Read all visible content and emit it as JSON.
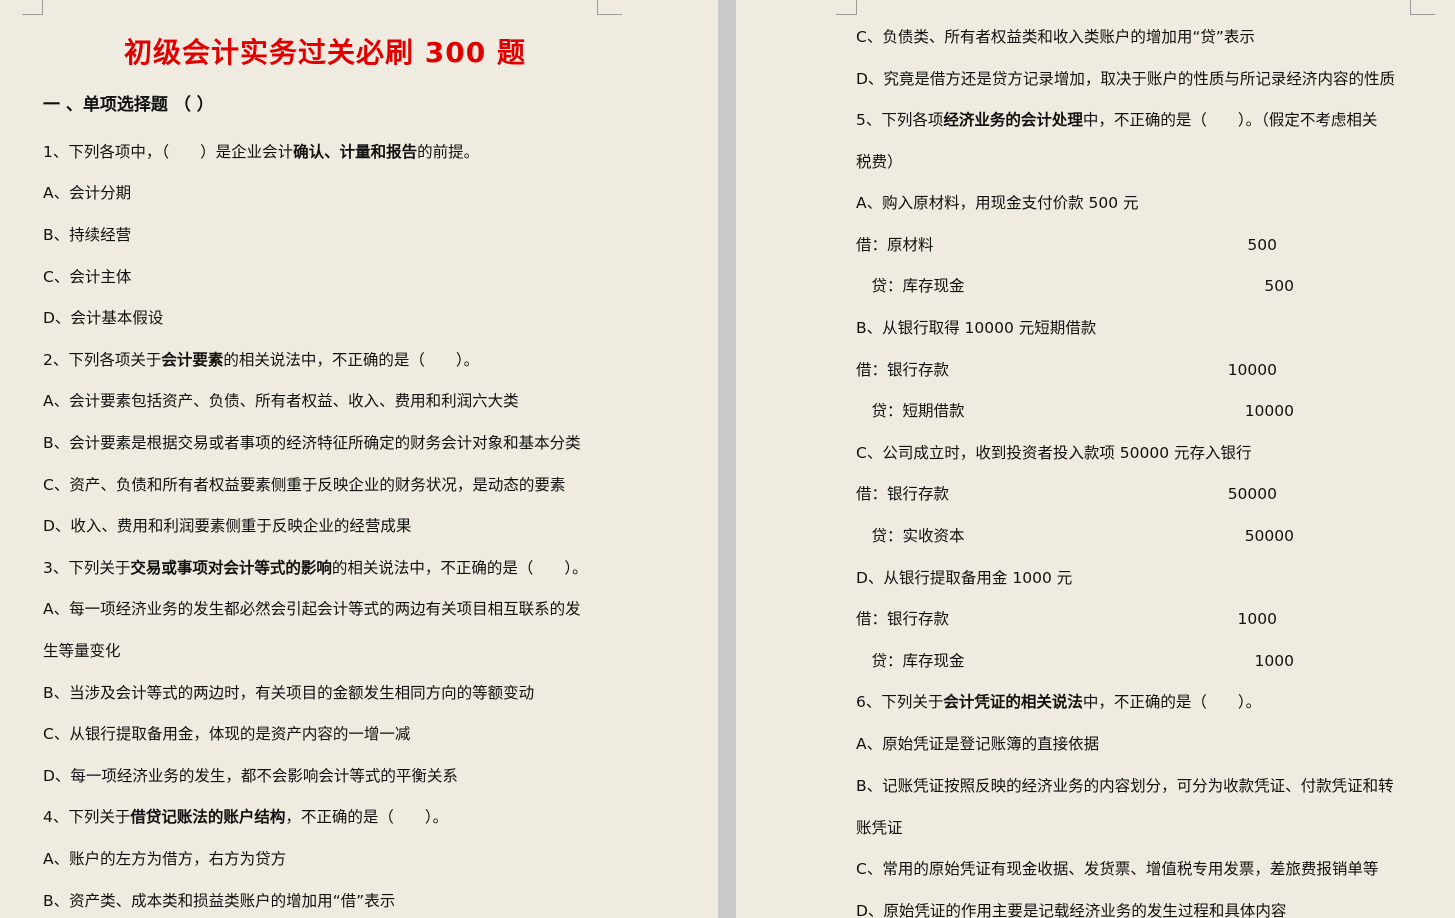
{
  "left": {
    "title": "初级会计实务过关必刷 300 题",
    "section": "一 、单项选择题 （ ）",
    "lines": [
      {
        "parts": [
          {
            "t": "1、下列各项中，（　　）是企业会计"
          },
          {
            "t": "确认、计量和报告",
            "b": true
          },
          {
            "t": "的前提。"
          }
        ]
      },
      {
        "parts": [
          {
            "t": "A、会计分期"
          }
        ]
      },
      {
        "parts": [
          {
            "t": "B、持续经营"
          }
        ]
      },
      {
        "parts": [
          {
            "t": "C、会计主体"
          }
        ]
      },
      {
        "parts": [
          {
            "t": "D、会计基本假设"
          }
        ]
      },
      {
        "parts": [
          {
            "t": "2、下列各项关于"
          },
          {
            "t": "会计要素",
            "b": true
          },
          {
            "t": "的相关说法中，不正确的是（　　）。"
          }
        ]
      },
      {
        "parts": [
          {
            "t": "A、会计要素包括资产、负债、所有者权益、收入、费用和利润六大类"
          }
        ]
      },
      {
        "parts": [
          {
            "t": "B、会计要素是根据交易或者事项的经济特征所确定的财务会计对象和基本分类"
          }
        ]
      },
      {
        "parts": [
          {
            "t": "C、资产、负债和所有者权益要素侧重于反映企业的财务状况，是动态的要素"
          }
        ]
      },
      {
        "parts": [
          {
            "t": "D、收入、费用和利润要素侧重于反映企业的经营成果"
          }
        ]
      },
      {
        "parts": [
          {
            "t": "3、下列关于"
          },
          {
            "t": "交易或事项对会计等式的影响",
            "b": true
          },
          {
            "t": "的相关说法中，不正确的是（　　）。"
          }
        ]
      },
      {
        "parts": [
          {
            "t": "A、每一项经济业务的发生都必然会引起会计等式的两边有关项目相互联系的发"
          }
        ]
      },
      {
        "parts": [
          {
            "t": "生等量变化"
          }
        ]
      },
      {
        "parts": [
          {
            "t": "B、当涉及会计等式的两边时，有关项目的金额发生相同方向的等额变动"
          }
        ]
      },
      {
        "parts": [
          {
            "t": "C、从银行提取备用金，体现的是资产内容的一增一减"
          }
        ]
      },
      {
        "parts": [
          {
            "t": "D、每一项经济业务的发生，都不会影响会计等式的平衡关系"
          }
        ]
      },
      {
        "parts": [
          {
            "t": "4、下列关于"
          },
          {
            "t": "借贷记账法的账户结构",
            "b": true
          },
          {
            "t": "，不正确的是（　　）。"
          }
        ]
      },
      {
        "parts": [
          {
            "t": "A、账户的左方为借方，右方为贷方"
          }
        ]
      },
      {
        "parts": [
          {
            "t": "B、资产类、成本类和损益类账户的增加用“借”表示"
          }
        ]
      }
    ]
  },
  "right": {
    "lines": [
      {
        "parts": [
          {
            "t": "C、负债类、所有者权益类和收入类账户的增加用“贷”表示"
          }
        ]
      },
      {
        "parts": [
          {
            "t": "D、究竟是借方还是贷方记录增加，取决于账户的性质与所记录经济内容的性质"
          }
        ]
      },
      {
        "parts": [
          {
            "t": "5、下列各项"
          },
          {
            "t": "经济业务的会计处理",
            "b": true
          },
          {
            "t": "中，不正确的是（　　）。（假定不考虑相关"
          }
        ]
      },
      {
        "parts": [
          {
            "t": "税费）"
          }
        ]
      },
      {
        "parts": [
          {
            "t": "A、购入原材料，用现金支付价款 500 元"
          }
        ]
      },
      {
        "parts": [
          {
            "t": "借：原材料"
          }
        ],
        "amt": "500"
      },
      {
        "parts": [
          {
            "t": "　贷：库存现金"
          }
        ],
        "amt": "500",
        "credit": true
      },
      {
        "parts": [
          {
            "t": "B、从银行取得 10000 元短期借款"
          }
        ]
      },
      {
        "parts": [
          {
            "t": "借：银行存款"
          }
        ],
        "amt": "10000"
      },
      {
        "parts": [
          {
            "t": "　贷：短期借款"
          }
        ],
        "amt": "10000",
        "credit": true
      },
      {
        "parts": [
          {
            "t": "C、公司成立时，收到投资者投入款项 50000 元存入银行"
          }
        ]
      },
      {
        "parts": [
          {
            "t": "借：银行存款"
          }
        ],
        "amt": "50000"
      },
      {
        "parts": [
          {
            "t": "　贷：实收资本"
          }
        ],
        "amt": "50000",
        "credit": true
      },
      {
        "parts": [
          {
            "t": "D、从银行提取备用金 1000 元"
          }
        ]
      },
      {
        "parts": [
          {
            "t": "借：银行存款"
          }
        ],
        "amt": "1000"
      },
      {
        "parts": [
          {
            "t": "　贷：库存现金"
          }
        ],
        "amt": "1000",
        "credit": true
      },
      {
        "parts": [
          {
            "t": "6、下列关于"
          },
          {
            "t": "会计凭证的相关说法",
            "b": true
          },
          {
            "t": "中，不正确的是（　　）。"
          }
        ]
      },
      {
        "parts": [
          {
            "t": "A、原始凭证是登记账簿的直接依据"
          }
        ]
      },
      {
        "parts": [
          {
            "t": "B、记账凭证按照反映的经济业务的内容划分，可分为收款凭证、付款凭证和转"
          }
        ]
      },
      {
        "parts": [
          {
            "t": "账凭证"
          }
        ]
      },
      {
        "parts": [
          {
            "t": "C、常用的原始凭证有现金收据、发货票、增值税专用发票，差旅费报销单等"
          }
        ]
      },
      {
        "parts": [
          {
            "t": "D、原始凭证的作用主要是记载经济业务的发生过程和具体内容"
          }
        ]
      }
    ]
  }
}
